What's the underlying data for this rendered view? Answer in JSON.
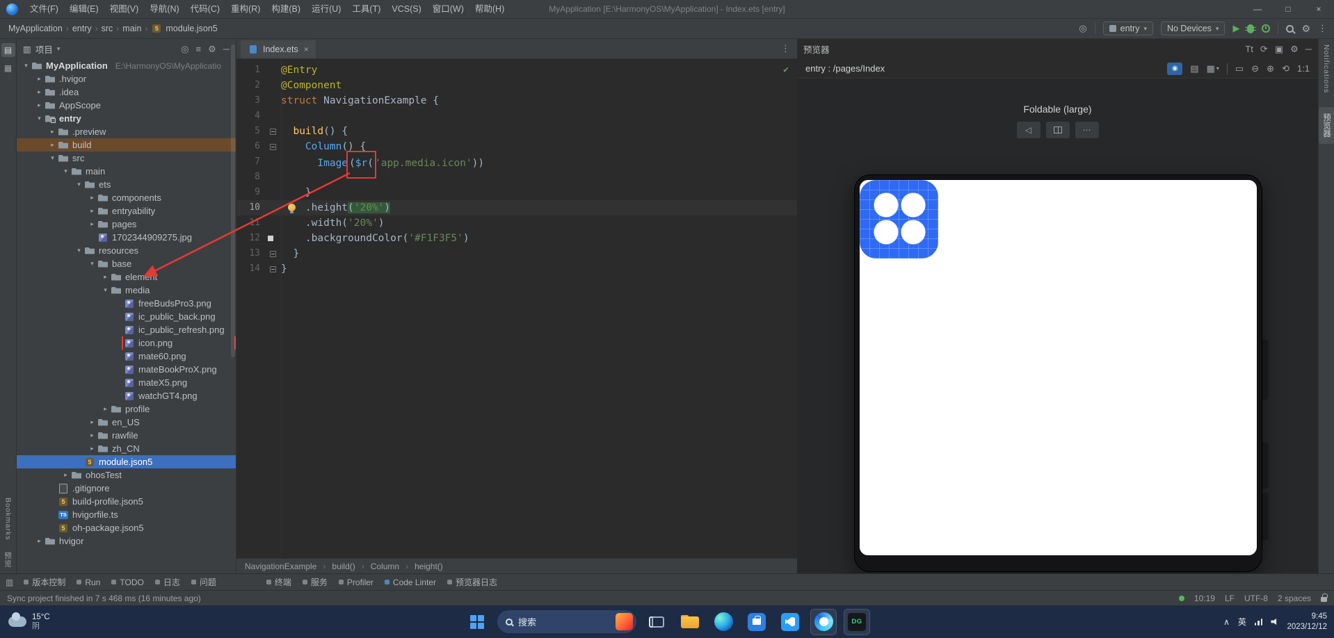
{
  "glyphs": {
    "caret_down": "▾",
    "chevron_open": "▾",
    "chevron_closed": "▸",
    "crumb_sep": "›",
    "gear": "⚙",
    "refresh": "⟳",
    "rotate": "⟲",
    "minus": "─",
    "kebab": "⋮",
    "more": "⋯",
    "back": "◁",
    "zoom_in": "⊕",
    "zoom_out": "⊖",
    "grid": "▦",
    "layers": "▤",
    "frame": "▭",
    "screen": "▣",
    "inspect": "◉",
    "target": "◎",
    "menu_lines": "≡",
    "font_size": "Tt",
    "play": "▶",
    "check": "✔",
    "close": "×",
    "win_min": "—",
    "win_max": "□",
    "tray_up": "∧",
    "panel": "▤",
    "tool_strip": "▥"
  },
  "titlebar": {
    "menus": [
      "文件(F)",
      "编辑(E)",
      "视图(V)",
      "导航(N)",
      "代码(C)",
      "重构(R)",
      "构建(B)",
      "运行(U)",
      "工具(T)",
      "VCS(S)",
      "窗口(W)",
      "帮助(H)"
    ],
    "title": "MyApplication [E:\\HarmonyOS\\MyApplication] - Index.ets [entry]"
  },
  "toolbar": {
    "breadcrumbs": [
      "MyApplication",
      "entry",
      "src",
      "main"
    ],
    "breadcrumb_file": "module.json5",
    "module_selector": "entry",
    "device_selector": "No Devices"
  },
  "project_panel": {
    "title": "项目",
    "tree": [
      {
        "label": "MyApplication",
        "path": "E:\\HarmonyOS\\MyApplicatio",
        "depth": 0,
        "icon": "folder",
        "chevron": "open",
        "bold": true
      },
      {
        "label": ".hvigor",
        "depth": 1,
        "icon": "folder",
        "chevron": "closed"
      },
      {
        "label": ".idea",
        "depth": 1,
        "icon": "folder",
        "chevron": "closed"
      },
      {
        "label": "AppScope",
        "depth": 1,
        "icon": "folder",
        "chevron": "closed"
      },
      {
        "label": "entry",
        "depth": 1,
        "icon": "module",
        "chevron": "open",
        "bold": true
      },
      {
        "label": ".preview",
        "depth": 2,
        "icon": "folder",
        "chevron": "closed"
      },
      {
        "label": "build",
        "depth": 2,
        "icon": "folder",
        "chevron": "closed",
        "highlight": true
      },
      {
        "label": "src",
        "depth": 2,
        "icon": "folder",
        "chevron": "open"
      },
      {
        "label": "main",
        "depth": 3,
        "icon": "folder",
        "chevron": "open"
      },
      {
        "label": "ets",
        "depth": 4,
        "icon": "folder",
        "chevron": "open"
      },
      {
        "label": "components",
        "depth": 5,
        "icon": "folder",
        "chevron": "closed"
      },
      {
        "label": "entryability",
        "depth": 5,
        "icon": "folder",
        "chevron": "closed"
      },
      {
        "label": "pages",
        "depth": 5,
        "icon": "folder",
        "chevron": "closed"
      },
      {
        "label": "1702344909275.jpg",
        "depth": 5,
        "icon": "image"
      },
      {
        "label": "resources",
        "depth": 4,
        "icon": "folder",
        "chevron": "open"
      },
      {
        "label": "base",
        "depth": 5,
        "icon": "folder",
        "chevron": "open"
      },
      {
        "label": "element",
        "depth": 6,
        "icon": "folder",
        "chevron": "closed"
      },
      {
        "label": "media",
        "depth": 6,
        "icon": "folder",
        "chevron": "open"
      },
      {
        "label": "freeBudsPro3.png",
        "depth": 7,
        "icon": "image"
      },
      {
        "label": "ic_public_back.png",
        "depth": 7,
        "icon": "image"
      },
      {
        "label": "ic_public_refresh.png",
        "depth": 7,
        "icon": "image"
      },
      {
        "label": "icon.png",
        "depth": 7,
        "icon": "image",
        "annotated": true
      },
      {
        "label": "mate60.png",
        "depth": 7,
        "icon": "image"
      },
      {
        "label": "mateBookProX.png",
        "depth": 7,
        "icon": "image"
      },
      {
        "label": "mateX5.png",
        "depth": 7,
        "icon": "image"
      },
      {
        "label": "watchGT4.png",
        "depth": 7,
        "icon": "image"
      },
      {
        "label": "profile",
        "depth": 6,
        "icon": "folder",
        "chevron": "closed"
      },
      {
        "label": "en_US",
        "depth": 5,
        "icon": "folder",
        "chevron": "closed"
      },
      {
        "label": "rawfile",
        "depth": 5,
        "icon": "folder",
        "chevron": "closed"
      },
      {
        "label": "zh_CN",
        "depth": 5,
        "icon": "folder",
        "chevron": "closed"
      },
      {
        "label": "module.json5",
        "depth": 4,
        "icon": "json5",
        "selected": true
      },
      {
        "label": "ohosTest",
        "depth": 3,
        "icon": "folder",
        "chevron": "closed"
      },
      {
        "label": ".gitignore",
        "depth": 2,
        "icon": "file"
      },
      {
        "label": "build-profile.json5",
        "depth": 2,
        "icon": "json5"
      },
      {
        "label": "hvigorfile.ts",
        "depth": 2,
        "icon": "ts"
      },
      {
        "label": "oh-package.json5",
        "depth": 2,
        "icon": "json5"
      },
      {
        "label": "hvigor",
        "depth": 1,
        "icon": "folder",
        "chevron": "closed"
      }
    ]
  },
  "editor": {
    "tab": "Index.ets",
    "breadcrumbs": [
      "NavigationExample",
      "build()",
      "Column",
      "height()"
    ],
    "lines": [
      {
        "n": 1,
        "segs": [
          {
            "c": "ann",
            "t": "@Entry"
          }
        ]
      },
      {
        "n": 2,
        "segs": [
          {
            "c": "ann",
            "t": "@Component"
          }
        ]
      },
      {
        "n": 3,
        "segs": [
          {
            "c": "kw",
            "t": "struct "
          },
          {
            "c": "pln",
            "t": "NavigationExample {"
          }
        ]
      },
      {
        "n": 4,
        "segs": []
      },
      {
        "n": 5,
        "fold": true,
        "segs": [
          {
            "c": "pln",
            "t": "  "
          },
          {
            "c": "fn",
            "t": "build"
          },
          {
            "c": "pln",
            "t": "() {"
          }
        ]
      },
      {
        "n": 6,
        "fold": true,
        "segs": [
          {
            "c": "pln",
            "t": "    "
          },
          {
            "c": "cmp",
            "t": "Column"
          },
          {
            "c": "pln",
            "t": "() {"
          }
        ]
      },
      {
        "n": 7,
        "segs": [
          {
            "c": "pln",
            "t": "      "
          },
          {
            "c": "cmp",
            "t": "Image"
          },
          {
            "c": "pln box",
            "t": "("
          },
          {
            "c": "cmp box",
            "t": "$r"
          },
          {
            "c": "pln box",
            "t": "("
          },
          {
            "c": "str",
            "t": "'app.media.icon'"
          },
          {
            "c": "pln",
            "t": "))"
          }
        ]
      },
      {
        "n": 8,
        "segs": []
      },
      {
        "n": 9,
        "segs": [
          {
            "c": "pln",
            "t": "    }"
          }
        ]
      },
      {
        "n": 10,
        "current": true,
        "bulb": true,
        "segs": [
          {
            "c": "pln",
            "t": "    .height"
          },
          {
            "c": "pln hl",
            "t": "("
          },
          {
            "c": "str hl",
            "t": "'20%'"
          },
          {
            "c": "pln hl",
            "t": ")"
          }
        ]
      },
      {
        "n": 11,
        "segs": [
          {
            "c": "pln",
            "t": "    .width("
          },
          {
            "c": "str",
            "t": "'20%'"
          },
          {
            "c": "pln",
            "t": ")"
          }
        ]
      },
      {
        "n": 12,
        "marker": true,
        "segs": [
          {
            "c": "pln",
            "t": "    .backgroundColor("
          },
          {
            "c": "str",
            "t": "'#F1F3F5'"
          },
          {
            "c": "pln",
            "t": ")"
          }
        ]
      },
      {
        "n": 13,
        "fold": true,
        "segs": [
          {
            "c": "pln",
            "t": "  }"
          }
        ]
      },
      {
        "n": 14,
        "fold": true,
        "segs": [
          {
            "c": "pln",
            "t": "}"
          }
        ]
      }
    ]
  },
  "previewer": {
    "title": "预览器",
    "page": "entry : /pages/Index",
    "device_label": "Foldable (large)",
    "zoom_label": "1:1"
  },
  "side_strips": {
    "left_bottom": [
      "Bookmarks",
      "预览"
    ],
    "right_top": "Notifications",
    "right_tab": "预览器"
  },
  "tool_buttons": {
    "group1": [
      "版本控制",
      "Run",
      "TODO",
      "日志",
      "问题"
    ],
    "group2": [
      "终端",
      "服务",
      "Profiler",
      "Code Linter",
      "预览器日志"
    ]
  },
  "statusbar": {
    "message": "Sync project finished in 7 s 468 ms (16 minutes ago)",
    "time": "10:19",
    "line_sep": "LF",
    "encoding": "UTF-8",
    "indent": "2 spaces"
  },
  "taskbar": {
    "weather_temp": "15°C",
    "weather_desc": "阴",
    "search_label": "搜索",
    "dg_label": "DG",
    "tray_lang": "英",
    "clock_time": "9:45",
    "clock_date": "2023/12/12"
  }
}
